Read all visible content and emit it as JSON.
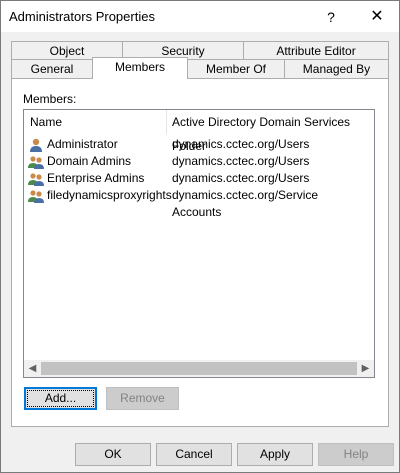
{
  "window": {
    "title": "Administrators Properties",
    "help_glyph": "?",
    "close_glyph": "✕"
  },
  "tabs_row1": [
    {
      "label": "Object"
    },
    {
      "label": "Security"
    },
    {
      "label": "Attribute Editor"
    }
  ],
  "tabs_row2": [
    {
      "label": "General"
    },
    {
      "label": "Members",
      "active": true
    },
    {
      "label": "Member Of"
    },
    {
      "label": "Managed By"
    }
  ],
  "members": {
    "label": "Members:",
    "columns": [
      "Name",
      "Active Directory Domain Services Folder"
    ],
    "rows": [
      {
        "name": "Administrator",
        "folder": "dynamics.cctec.org/Users",
        "icon": "user-icon"
      },
      {
        "name": "Domain Admins",
        "folder": "dynamics.cctec.org/Users",
        "icon": "group-icon"
      },
      {
        "name": "Enterprise Admins",
        "folder": "dynamics.cctec.org/Users",
        "icon": "group-icon"
      },
      {
        "name": "filedynamicsproxyrights",
        "folder": "dynamics.cctec.org/Service Accounts",
        "icon": "group-icon"
      }
    ]
  },
  "buttons": {
    "add": "Add...",
    "remove": "Remove",
    "ok": "OK",
    "cancel": "Cancel",
    "apply": "Apply",
    "help": "Help"
  }
}
